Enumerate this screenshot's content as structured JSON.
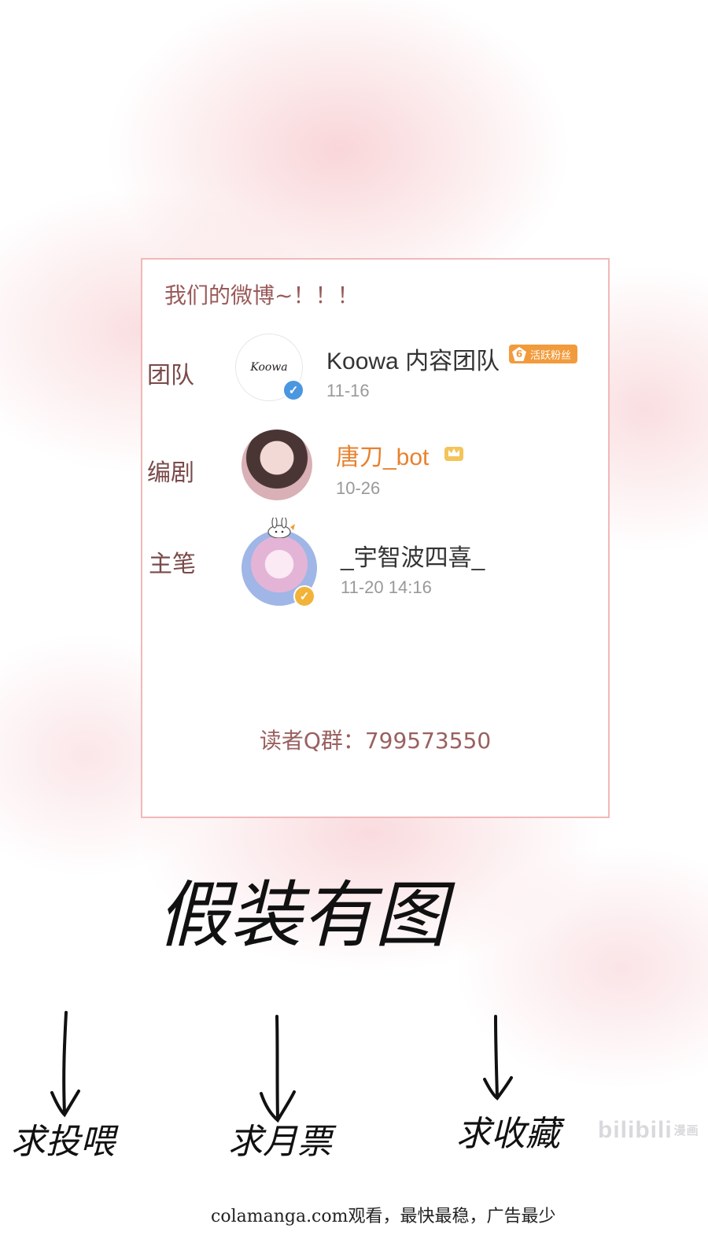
{
  "card": {
    "title": "我们的微博~！！！",
    "rows": [
      {
        "label": "团队",
        "name": "Koowa 内容团队",
        "date": "11-16",
        "badge_level": "6",
        "badge_text": "活跃粉丝",
        "avatar_text": "Koowa"
      },
      {
        "label": "编剧",
        "name": "唐刀_bot",
        "date": "10-26"
      },
      {
        "label": "主笔",
        "name": "_宇智波四喜_",
        "date": "11-20 14:16"
      }
    ],
    "qq_group": "读者Q群：799573550"
  },
  "handwriting": {
    "title": "假装有图",
    "asks": [
      "求投喂",
      "求月票",
      "求收藏"
    ]
  },
  "watermark": {
    "text": "bilibili",
    "suffix": "漫画"
  },
  "footer": "colamanga.com观看，最快最稳，广告最少",
  "colors": {
    "card_border": "#f2b8b8",
    "label": "#7a4a4a",
    "orange_name": "#e8822f",
    "verified_blue": "#4a97e0",
    "verified_gold": "#f2b33a"
  }
}
